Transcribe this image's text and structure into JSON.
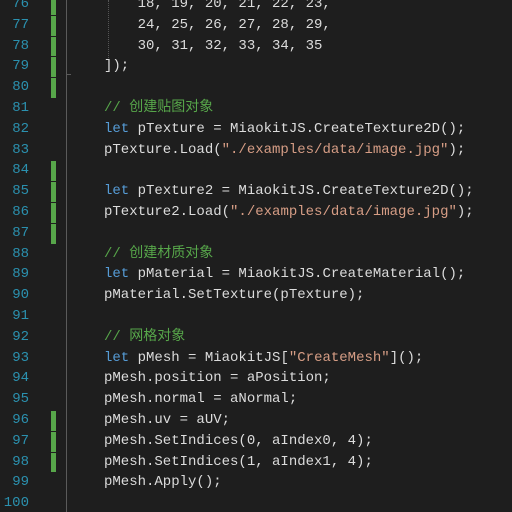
{
  "editor": {
    "lines": [
      {
        "num": "76",
        "changed": true,
        "tokens": [
          {
            "t": "    18, 19, 20, 21, 22, 23,",
            "c": "tx"
          }
        ]
      },
      {
        "num": "77",
        "changed": true,
        "tokens": [
          {
            "t": "    24, 25, 26, 27, 28, 29,",
            "c": "tx"
          }
        ]
      },
      {
        "num": "78",
        "changed": true,
        "tokens": [
          {
            "t": "    30, 31, 32, 33, 34, 35",
            "c": "tx"
          }
        ]
      },
      {
        "num": "79",
        "changed": true,
        "tokens": [
          {
            "t": "]);",
            "c": "tx"
          }
        ]
      },
      {
        "num": "80",
        "changed": true,
        "tokens": []
      },
      {
        "num": "81",
        "changed": false,
        "tokens": [
          {
            "t": "// 创建贴图对象",
            "c": "cm"
          }
        ]
      },
      {
        "num": "82",
        "changed": false,
        "tokens": [
          {
            "t": "let",
            "c": "kw"
          },
          {
            "t": " pTexture = MiaokitJS.CreateTexture2D();",
            "c": "tx"
          }
        ]
      },
      {
        "num": "83",
        "changed": false,
        "tokens": [
          {
            "t": "pTexture.Load(",
            "c": "tx"
          },
          {
            "t": "\"./examples/data/image.jpg\"",
            "c": "str"
          },
          {
            "t": ");",
            "c": "tx"
          }
        ]
      },
      {
        "num": "84",
        "changed": true,
        "tokens": []
      },
      {
        "num": "85",
        "changed": true,
        "tokens": [
          {
            "t": "let",
            "c": "kw"
          },
          {
            "t": " pTexture2 = MiaokitJS.CreateTexture2D();",
            "c": "tx"
          }
        ]
      },
      {
        "num": "86",
        "changed": true,
        "tokens": [
          {
            "t": "pTexture2.Load(",
            "c": "tx"
          },
          {
            "t": "\"./examples/data/image.jpg\"",
            "c": "str"
          },
          {
            "t": ");",
            "c": "tx"
          }
        ]
      },
      {
        "num": "87",
        "changed": true,
        "tokens": []
      },
      {
        "num": "88",
        "changed": false,
        "tokens": [
          {
            "t": "// 创建材质对象",
            "c": "cm"
          }
        ]
      },
      {
        "num": "89",
        "changed": false,
        "tokens": [
          {
            "t": "let",
            "c": "kw"
          },
          {
            "t": " pMaterial = MiaokitJS.CreateMaterial();",
            "c": "tx"
          }
        ]
      },
      {
        "num": "90",
        "changed": false,
        "tokens": [
          {
            "t": "pMaterial.SetTexture(pTexture);",
            "c": "tx"
          }
        ]
      },
      {
        "num": "91",
        "changed": false,
        "tokens": []
      },
      {
        "num": "92",
        "changed": false,
        "tokens": [
          {
            "t": "// 网格对象",
            "c": "cm"
          }
        ]
      },
      {
        "num": "93",
        "changed": false,
        "tokens": [
          {
            "t": "let",
            "c": "kw"
          },
          {
            "t": " pMesh = MiaokitJS[",
            "c": "tx"
          },
          {
            "t": "\"CreateMesh\"",
            "c": "str"
          },
          {
            "t": "]();",
            "c": "tx"
          }
        ]
      },
      {
        "num": "94",
        "changed": false,
        "tokens": [
          {
            "t": "pMesh.position = aPosition;",
            "c": "tx"
          }
        ]
      },
      {
        "num": "95",
        "changed": false,
        "tokens": [
          {
            "t": "pMesh.normal = aNormal;",
            "c": "tx"
          }
        ]
      },
      {
        "num": "96",
        "changed": true,
        "tokens": [
          {
            "t": "pMesh.uv = aUV;",
            "c": "tx"
          }
        ]
      },
      {
        "num": "97",
        "changed": true,
        "tokens": [
          {
            "t": "pMesh.SetIndices(0, aIndex0, 4);",
            "c": "tx"
          }
        ]
      },
      {
        "num": "98",
        "changed": true,
        "tokens": [
          {
            "t": "pMesh.SetIndices(1, aIndex1, 4);",
            "c": "tx"
          }
        ]
      },
      {
        "num": "99",
        "changed": false,
        "tokens": [
          {
            "t": "pMesh.Apply();",
            "c": "tx"
          }
        ]
      },
      {
        "num": "100",
        "changed": false,
        "tokens": []
      }
    ]
  },
  "colors": {
    "background": "#1e1e1e",
    "line_number": "#2b91af",
    "keyword": "#569cd6",
    "comment": "#57a64a",
    "string": "#d69d85",
    "text": "#dcdcdc",
    "change_marker": "#57a64a"
  }
}
